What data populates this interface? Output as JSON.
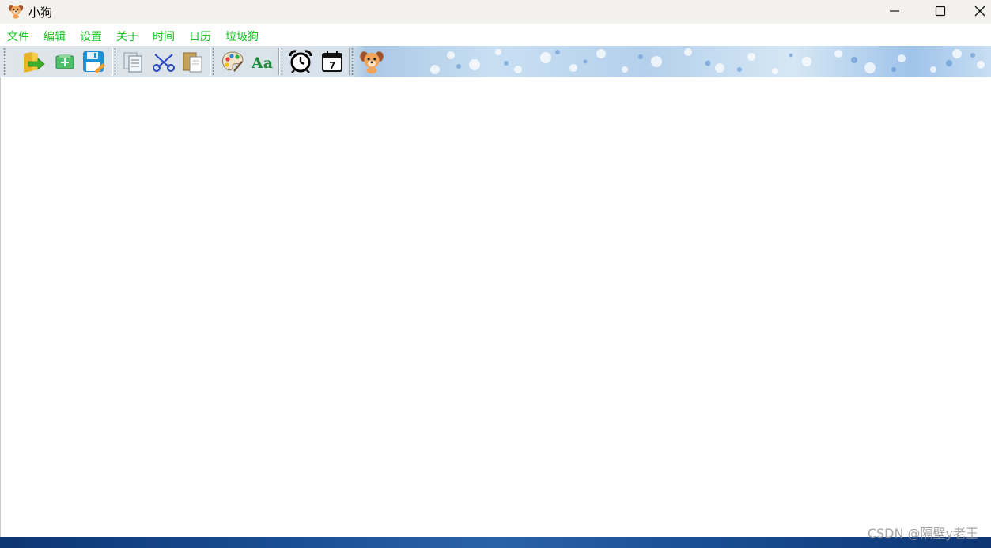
{
  "window": {
    "title": "小狗",
    "app_icon": "puppy-icon",
    "controls": [
      "minimize-icon",
      "maximize-icon",
      "close-icon"
    ]
  },
  "menu": {
    "items": [
      "文件",
      "编辑",
      "设置",
      "关于",
      "时间",
      "日历",
      "垃圾狗"
    ],
    "color": "#10c51c"
  },
  "toolbar": {
    "groups": [
      [
        "open-folder-icon",
        "new-icon",
        "save-icon"
      ],
      [
        "copy-icon",
        "cut-icon",
        "paste-icon"
      ],
      [
        "color-palette-icon",
        "font-icon"
      ],
      [
        "alarm-clock-icon",
        "calendar-icon"
      ],
      [
        "puppy-icon"
      ]
    ],
    "font_icon_text": "Aa",
    "calendar_icon_text": "7"
  },
  "editor": {
    "content": ""
  },
  "watermark": "CSDN @隔壁y老王"
}
